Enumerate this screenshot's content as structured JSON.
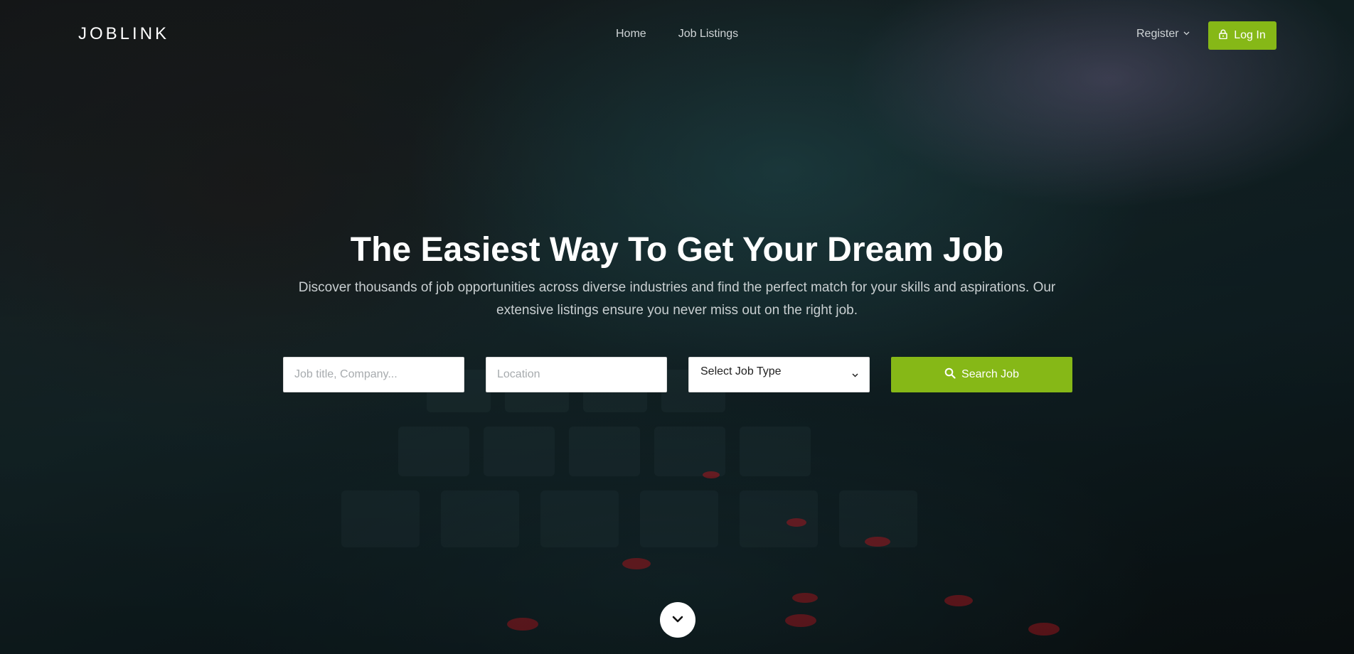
{
  "brand": "JOBLINK",
  "nav": {
    "items": [
      "Home",
      "Job Listings"
    ],
    "register_label": "Register",
    "login_label": "Log In"
  },
  "hero": {
    "title": "The Easiest Way To Get Your Dream Job",
    "subtitle": "Discover thousands of job opportunities across diverse industries and find the perfect match for your skills and aspirations. Our extensive listings ensure you never miss out on the right job."
  },
  "search": {
    "job_placeholder": "Job title, Company...",
    "location_placeholder": "Location",
    "job_type_selected": "Select Job Type",
    "button_label": "Search Job"
  },
  "colors": {
    "accent": "#86b817",
    "background": "#0d1113"
  },
  "icons": {
    "login": "lock-icon",
    "search": "search-icon",
    "scroll": "chevron-down-icon"
  }
}
